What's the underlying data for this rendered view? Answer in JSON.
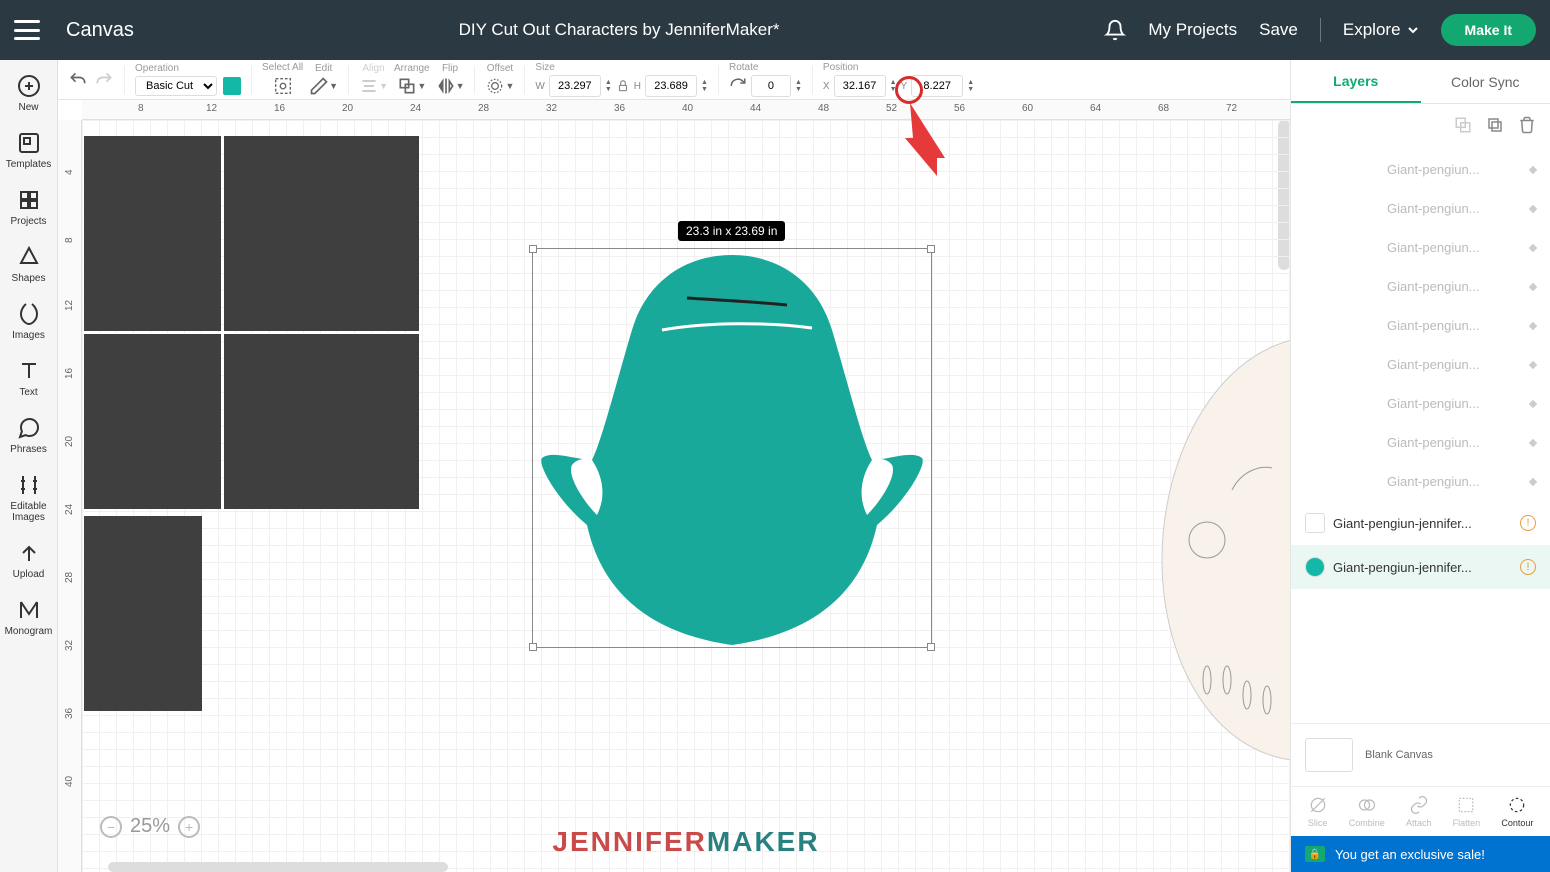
{
  "topbar": {
    "app_title": "Canvas",
    "project_title": "DIY Cut Out Characters by JenniferMaker*",
    "my_projects": "My Projects",
    "save": "Save",
    "explore": "Explore",
    "make_it": "Make It"
  },
  "leftbar": {
    "items": [
      {
        "label": "New",
        "icon": "plus-circle-icon"
      },
      {
        "label": "Templates",
        "icon": "templates-icon"
      },
      {
        "label": "Projects",
        "icon": "projects-icon"
      },
      {
        "label": "Shapes",
        "icon": "shapes-icon"
      },
      {
        "label": "Images",
        "icon": "images-icon"
      },
      {
        "label": "Text",
        "icon": "text-icon"
      },
      {
        "label": "Phrases",
        "icon": "phrases-icon"
      },
      {
        "label": "Editable Images",
        "icon": "editable-images-icon"
      },
      {
        "label": "Upload",
        "icon": "upload-icon"
      },
      {
        "label": "Monogram",
        "icon": "monogram-icon"
      }
    ]
  },
  "toolbar": {
    "operation_label": "Operation",
    "operation_value": "Basic Cut",
    "swatch_color": "#14b8a6",
    "select_all": "Select All",
    "edit": "Edit",
    "align": "Align",
    "arrange": "Arrange",
    "flip": "Flip",
    "offset": "Offset",
    "size_label": "Size",
    "w_label": "W",
    "w_value": "23.297",
    "h_label": "H",
    "h_value": "23.689",
    "rotate_label": "Rotate",
    "rotate_value": "0",
    "position_label": "Position",
    "x_label": "X",
    "x_value": "32.167",
    "y_label": "Y",
    "y_value": "8.227"
  },
  "canvas": {
    "ruler_h_ticks": [
      "8",
      "12",
      "16",
      "20",
      "24",
      "28",
      "32",
      "36",
      "40",
      "44",
      "48",
      "52",
      "56",
      "60",
      "64",
      "68",
      "72"
    ],
    "ruler_v_ticks": [
      "4",
      "8",
      "12",
      "16",
      "20",
      "24",
      "28",
      "32",
      "36",
      "40"
    ],
    "selection_size_label": "23.3  in x 23.69  in",
    "zoom_value": "25%"
  },
  "rightpanel": {
    "tabs": {
      "layers": "Layers",
      "color_sync": "Color Sync"
    },
    "layers": [
      {
        "name": "Giant-pengiun...",
        "faded": true
      },
      {
        "name": "Giant-pengiun...",
        "faded": true
      },
      {
        "name": "Giant-pengiun...",
        "faded": true
      },
      {
        "name": "Giant-pengiun...",
        "faded": true
      },
      {
        "name": "Giant-pengiun...",
        "faded": true
      },
      {
        "name": "Giant-pengiun...",
        "faded": true
      },
      {
        "name": "Giant-pengiun...",
        "faded": true
      },
      {
        "name": "Giant-pengiun...",
        "faded": true
      },
      {
        "name": "Giant-pengiun...",
        "faded": true
      },
      {
        "name": "Giant-pengiun-jennifer...",
        "faded": false,
        "warn": true,
        "thumb_color": "#fff"
      },
      {
        "name": "Giant-pengiun-jennifer...",
        "faded": false,
        "warn": true,
        "selected": true,
        "thumb_color": "#14b8a6"
      }
    ],
    "blank_canvas": "Blank Canvas",
    "bottom_tools": [
      {
        "label": "Slice"
      },
      {
        "label": "Combine"
      },
      {
        "label": "Attach"
      },
      {
        "label": "Flatten"
      },
      {
        "label": "Contour",
        "active": true
      }
    ],
    "sale_text": "You get an exclusive sale!"
  },
  "watermark": {
    "part1": "JENNIFER",
    "part2": "MAKER"
  }
}
